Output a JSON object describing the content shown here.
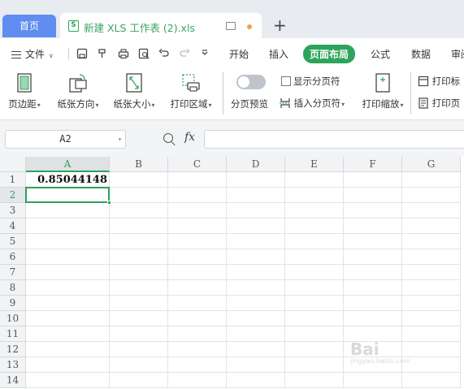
{
  "tabs": {
    "home_label": "首页",
    "file_title": "新建 XLS 工作表 (2).xls",
    "new_tab": "+"
  },
  "menu": {
    "file_label": "文件",
    "tabs": [
      "开始",
      "插入",
      "页面布局",
      "公式",
      "数据",
      "审阅"
    ],
    "active_tab": "页面布局"
  },
  "ribbon": {
    "margins": "页边距",
    "orientation": "纸张方向",
    "size": "纸张大小",
    "print_area": "打印区域",
    "page_break_preview": "分页预览",
    "show_page_breaks": "显示分页符",
    "insert_page_break": "插入分页符",
    "print_scaling": "打印缩放",
    "print_titles": "打印标",
    "print_page": "打印页"
  },
  "formula_bar": {
    "name_box": "A2",
    "fx": "fx",
    "formula": ""
  },
  "sheet": {
    "columns": [
      "A",
      "B",
      "C",
      "D",
      "E",
      "F",
      "G"
    ],
    "rows": [
      "1",
      "2",
      "3",
      "4",
      "5",
      "6",
      "7",
      "8",
      "9",
      "10",
      "11",
      "12",
      "13",
      "14"
    ],
    "selected_column": "A",
    "selected_row": "2",
    "cells": {
      "A1": "0.85044148"
    }
  },
  "watermark": {
    "text": "Bai",
    "sub": "jingyan.baidu.com"
  },
  "colors": {
    "accent": "#2ca45c",
    "home_tab": "#5f8df0",
    "tabbar": "#e8ecf1"
  }
}
